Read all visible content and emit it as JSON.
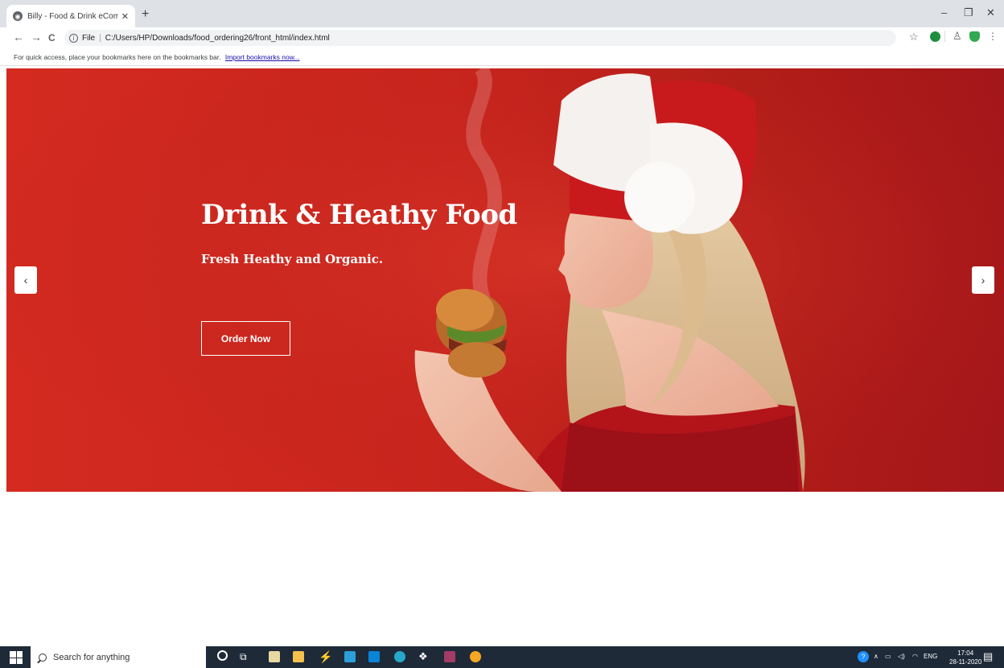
{
  "browser": {
    "tab_title": "Billy - Food & Drink eCommerce",
    "tab_close": "✕",
    "new_tab": "+",
    "window_controls": {
      "minimize": "–",
      "restore": "❐",
      "close": "✕"
    },
    "nav": {
      "back": "←",
      "forward": "→",
      "reload": "C"
    },
    "address": {
      "scheme_label": "File",
      "url": "C:/Users/HP/Downloads/food_ordering26/front_html/index.html"
    },
    "bookmarks_bar": {
      "text": "For quick access, place your bookmarks here on the bookmarks bar.",
      "link": "Import bookmarks now..."
    }
  },
  "hero": {
    "title": "Drink & Heathy Food",
    "subtitle": "Fresh Heathy and Organic.",
    "cta_label": "Order Now",
    "prev_label": "‹",
    "next_label": "›",
    "background_color": "#c9251d"
  },
  "taskbar": {
    "search_placeholder": "Search for anything",
    "tray": {
      "language": "ENG"
    },
    "clock": {
      "time": "17:04",
      "date": "28-11-2020"
    }
  }
}
